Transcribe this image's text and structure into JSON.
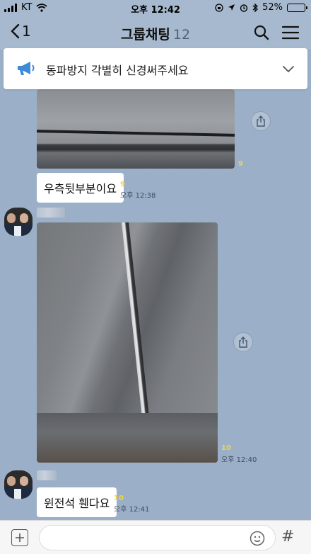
{
  "status_bar": {
    "carrier": "KT",
    "time": "오후 12:42",
    "battery": "52%",
    "battery_level": 0.52
  },
  "header": {
    "back_count": "1",
    "title": "그룹채팅",
    "member_count": "12"
  },
  "notice": {
    "text": "동파방지 각별히 신경써주세요"
  },
  "messages": [
    {
      "type": "photo",
      "unread": "9"
    },
    {
      "type": "text",
      "text": "우측뒷부분이요",
      "unread": "9",
      "time": "오후 12:38"
    },
    {
      "type": "photo",
      "unread": "10",
      "time": "오후 12:40"
    },
    {
      "type": "text",
      "text": "윈전석 휀다요",
      "unread": "10",
      "time": "오후 12:41"
    }
  ],
  "input": {
    "placeholder": "",
    "hash_symbol": "#"
  },
  "colors": {
    "chat_bg": "#9bb0c8",
    "unread": "#f5d23b",
    "notice_icon": "#3f8ad6"
  },
  "icons": [
    "back-chevron",
    "search",
    "menu",
    "megaphone",
    "chevron-down",
    "share",
    "plus",
    "emoji"
  ]
}
